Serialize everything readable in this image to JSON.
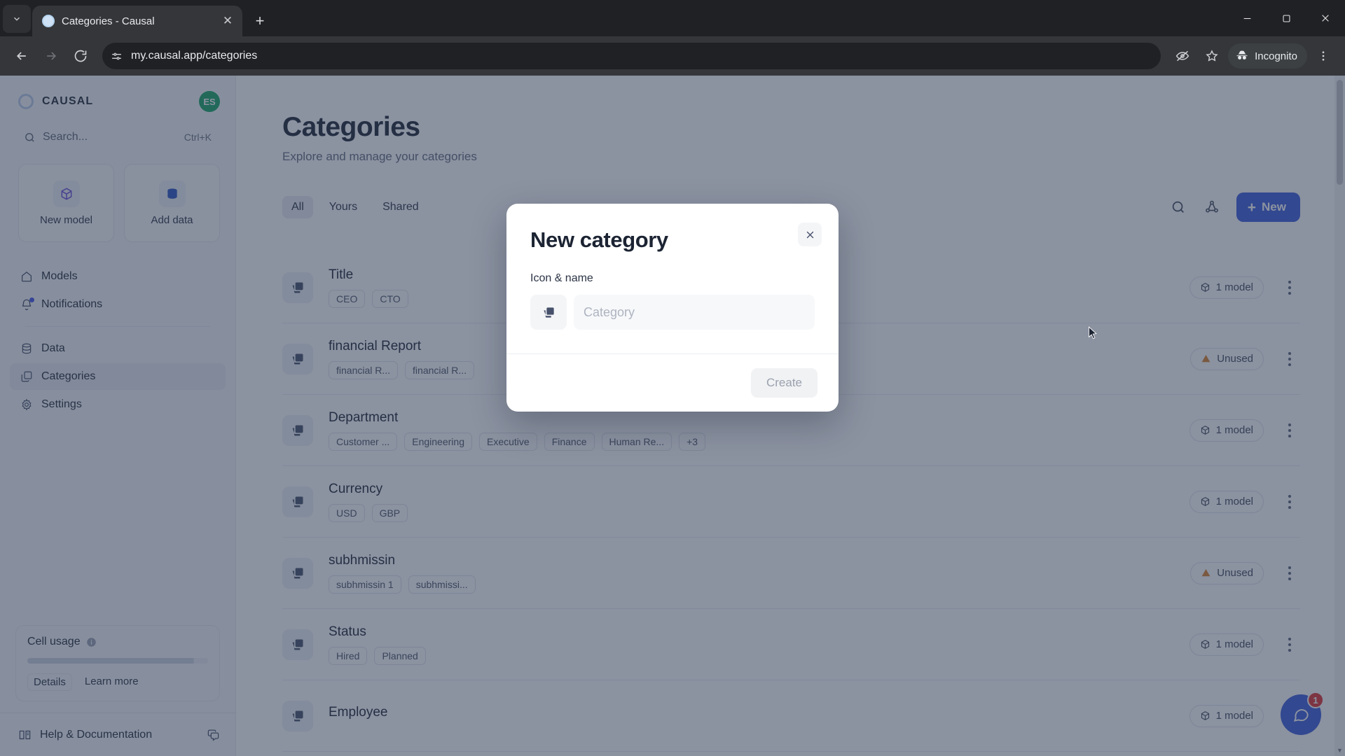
{
  "browser": {
    "tab": {
      "title": "Categories - Causal",
      "favicon": "globe-icon",
      "close": "✕"
    },
    "new_tab": "+",
    "tabstrip_chevron": "⌄",
    "nav": {
      "back": "←",
      "forward": "→",
      "reload": "⟳"
    },
    "omnibox": {
      "url": "my.causal.app/categories",
      "site_info_icon": "tune-icon"
    },
    "right": {
      "third_party_cookies_icon": "eye-crossed-icon",
      "bookmark_icon": "star-icon",
      "incognito_label": "Incognito",
      "menu_icon": "kebab-icon"
    },
    "window": {
      "minimize": "—",
      "maximize": "▢",
      "close": "✕"
    }
  },
  "sidebar": {
    "brand": "CAUSAL",
    "avatar": "ES",
    "search": {
      "placeholder": "Search...",
      "shortcut": "Ctrl+K"
    },
    "quick_actions": [
      {
        "label": "New model",
        "icon": "cube-icon"
      },
      {
        "label": "Add data",
        "icon": "database-icon"
      }
    ],
    "nav_groups": [
      [
        {
          "label": "Models",
          "icon": "home-icon",
          "active": false,
          "badge": false
        },
        {
          "label": "Notifications",
          "icon": "bell-icon",
          "active": false,
          "badge": true
        }
      ],
      [
        {
          "label": "Data",
          "icon": "database-icon",
          "active": false,
          "badge": false
        },
        {
          "label": "Categories",
          "icon": "categories-icon",
          "active": true,
          "badge": false
        },
        {
          "label": "Settings",
          "icon": "gear-icon",
          "active": false,
          "badge": false
        }
      ]
    ],
    "usage": {
      "title": "Cell usage",
      "info_icon": "info-icon",
      "progress_percent": 92,
      "details_label": "Details",
      "learn_more_label": "Learn more"
    },
    "help": {
      "label": "Help & Documentation",
      "icon": "book-icon",
      "chat_icon": "chat-icon"
    }
  },
  "main": {
    "title": "Categories",
    "subtitle": "Explore and manage your categories",
    "tabs": [
      {
        "label": "All",
        "active": true
      },
      {
        "label": "Yours",
        "active": false
      },
      {
        "label": "Shared",
        "active": false
      }
    ],
    "tools": [
      {
        "name": "search-icon"
      },
      {
        "name": "graph-icon"
      }
    ],
    "new_button": {
      "label": "New",
      "plus": "+"
    },
    "rows": [
      {
        "title": "Title",
        "chips": [
          "CEO",
          "CTO"
        ],
        "status": {
          "label": "1 model",
          "icon": "cube-icon",
          "type": "model"
        }
      },
      {
        "title": "financial Report",
        "chips": [
          "financial R...",
          "financial R..."
        ],
        "status": {
          "label": "Unused",
          "icon": "warning-icon",
          "type": "unused"
        }
      },
      {
        "title": "Department",
        "chips": [
          "Customer ...",
          "Engineering",
          "Executive",
          "Finance",
          "Human Re...",
          "+3"
        ],
        "status": {
          "label": "1 model",
          "icon": "cube-icon",
          "type": "model"
        }
      },
      {
        "title": "Currency",
        "chips": [
          "USD",
          "GBP"
        ],
        "status": {
          "label": "1 model",
          "icon": "cube-icon",
          "type": "model"
        }
      },
      {
        "title": "subhmissin",
        "chips": [
          "subhmissin 1",
          "subhmissi..."
        ],
        "status": {
          "label": "Unused",
          "icon": "warning-icon",
          "type": "unused"
        }
      },
      {
        "title": "Status",
        "chips": [
          "Hired",
          "Planned"
        ],
        "status": {
          "label": "1 model",
          "icon": "cube-icon",
          "type": "model"
        }
      },
      {
        "title": "Employee",
        "chips": [],
        "status": {
          "label": "1 model",
          "icon": "cube-icon",
          "type": "model"
        }
      }
    ],
    "chat": {
      "unread": "1",
      "icon": "chat-icon"
    }
  },
  "modal": {
    "title": "New category",
    "close": "✕",
    "field_label": "Icon & name",
    "icon_button": "categories-icon",
    "name_input": {
      "value": "",
      "placeholder": "Category"
    },
    "create_label": "Create"
  },
  "colors": {
    "accent": "#3b5bdb",
    "avatar_green": "#18a565",
    "warning": "#d9822b",
    "badge_red": "#e03131"
  }
}
